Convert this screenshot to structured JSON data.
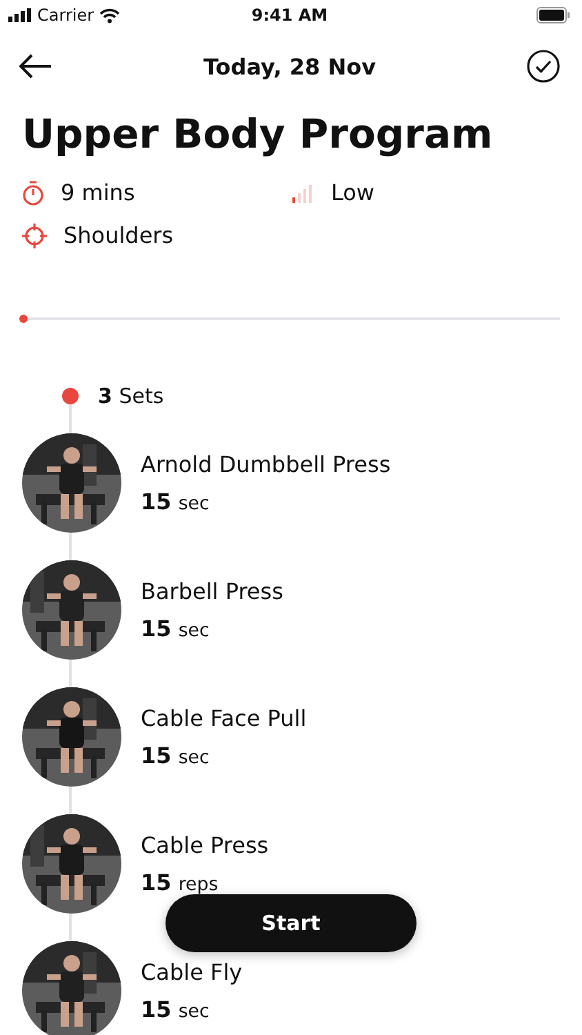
{
  "status_bar": {
    "carrier": "Carrier",
    "time": "9:41 AM"
  },
  "header": {
    "title": "Today, 28 Nov"
  },
  "program": {
    "title": "Upper Body Program",
    "duration": "9 mins",
    "intensity": {
      "label": "Low",
      "level": 0.25
    },
    "focus": "Shoulders"
  },
  "progress": {
    "level": 0
  },
  "sets": {
    "count": "3",
    "label": "Sets"
  },
  "exercises": [
    {
      "name": "Arnold Dumbbell Press",
      "amount": "15",
      "unit": "sec",
      "kind": "picture"
    },
    {
      "name": "Barbell Press",
      "amount": "15",
      "unit": "sec",
      "kind": "picture"
    },
    {
      "name": "Cable Face Pull",
      "amount": "15",
      "unit": "sec",
      "kind": "picture"
    },
    {
      "name": "Cable Press",
      "amount": "15",
      "unit": "reps",
      "kind": "picture"
    },
    {
      "name": "Cable Fly",
      "amount": "15",
      "unit": "sec",
      "kind": "picture"
    }
  ],
  "start_button": "Start"
}
